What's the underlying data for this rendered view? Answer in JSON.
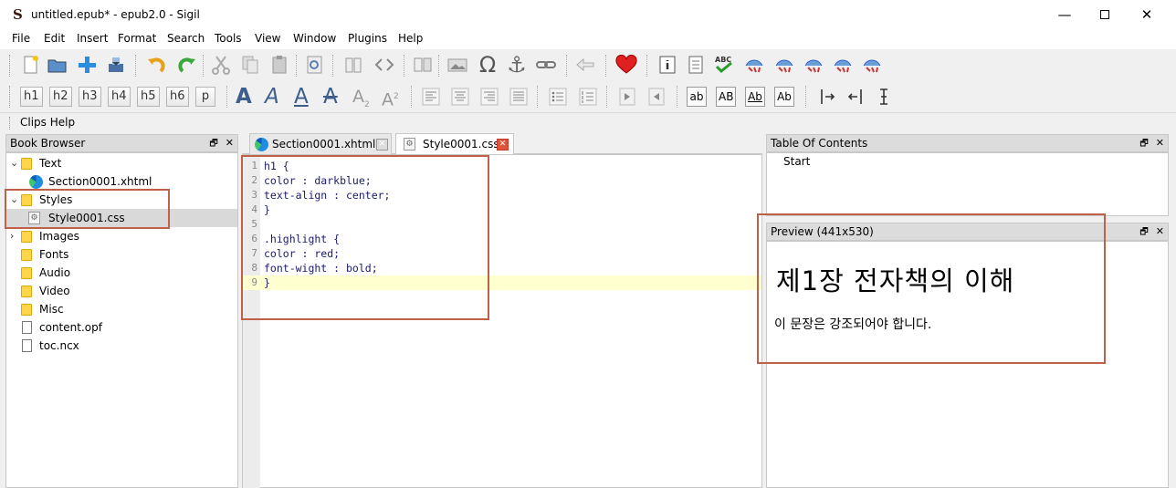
{
  "window": {
    "title": "untitled.epub* - epub2.0 - Sigil",
    "logo_letter": "S",
    "minimize": "—",
    "close": "✕"
  },
  "menu": [
    "File",
    "Edit",
    "Insert",
    "Format",
    "Search",
    "Tools",
    "View",
    "Window",
    "Plugins",
    "Help"
  ],
  "toolbar_headings": [
    "h1",
    "h2",
    "h3",
    "h4",
    "h5",
    "h6",
    "p"
  ],
  "toolbar_case": [
    "ab",
    "AB",
    "Ab",
    "Ab"
  ],
  "clips_label": "Clips Help",
  "book_browser": {
    "title": "Book Browser",
    "items": [
      {
        "label": "Text",
        "kind": "folder",
        "expanded": true
      },
      {
        "label": "Section0001.xhtml",
        "kind": "xhtml"
      },
      {
        "label": "Styles",
        "kind": "folder",
        "expanded": true
      },
      {
        "label": "Style0001.css",
        "kind": "css",
        "selected": true
      },
      {
        "label": "Images",
        "kind": "folder",
        "expanded": false
      },
      {
        "label": "Fonts",
        "kind": "folder"
      },
      {
        "label": "Audio",
        "kind": "folder"
      },
      {
        "label": "Video",
        "kind": "folder"
      },
      {
        "label": "Misc",
        "kind": "folder"
      },
      {
        "label": "content.opf",
        "kind": "file"
      },
      {
        "label": "toc.ncx",
        "kind": "file"
      }
    ]
  },
  "tabs": [
    {
      "label": "Section0001.xhtml",
      "active": false
    },
    {
      "label": "Style0001.css",
      "active": true
    }
  ],
  "code": {
    "line_numbers": [
      "1",
      "2",
      "3",
      "4",
      "5",
      "6",
      "7",
      "8",
      "9"
    ],
    "lines": [
      "h1 {",
      "color : darkblue;",
      "text-align : center;",
      "}",
      "",
      ".highlight {",
      "color : red;",
      "font-wight : bold;",
      "}"
    ],
    "current_line": 9
  },
  "toc": {
    "title": "Table Of Contents",
    "entries": [
      "Start"
    ]
  },
  "preview": {
    "title": "Preview (441x530)",
    "heading": "제1장 전자책의 이해",
    "paragraph": "이 문장은 강조되어야 합니다."
  },
  "panel_controls": {
    "float": "🗗",
    "close": "✕"
  },
  "colors": {
    "annotation": "#c0604a",
    "current_line": "#ffffd0",
    "selection": "#d9d9d9"
  }
}
